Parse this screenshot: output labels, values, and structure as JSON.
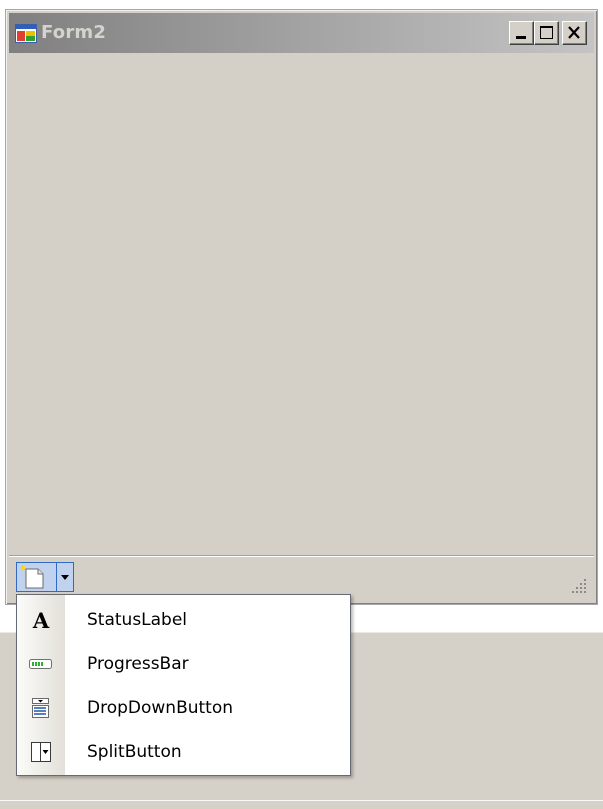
{
  "window": {
    "title": "Form2",
    "controls": {
      "minimize": "minimize-icon",
      "maximize": "maximize-icon",
      "close": "close-icon"
    }
  },
  "status_strip": {
    "add_item_button": {
      "icon": "add-item-icon",
      "dropdown_icon": "dropdown-arrow-icon"
    },
    "size_grip_icon": "size-grip-icon"
  },
  "dropdown_menu": {
    "items": [
      {
        "label": "StatusLabel",
        "icon": "status-label-icon"
      },
      {
        "label": "ProgressBar",
        "icon": "progress-bar-icon"
      },
      {
        "label": "DropDownButton",
        "icon": "dropdown-button-icon"
      },
      {
        "label": "SplitButton",
        "icon": "split-button-icon"
      }
    ]
  },
  "colors": {
    "window_face": "#d4d0c8",
    "title_bar_start": "#808080",
    "title_bar_end": "#c4c4c4",
    "title_text": "#d6d3ce",
    "menu_border": "#666a77",
    "highlight": "#316ac5"
  }
}
